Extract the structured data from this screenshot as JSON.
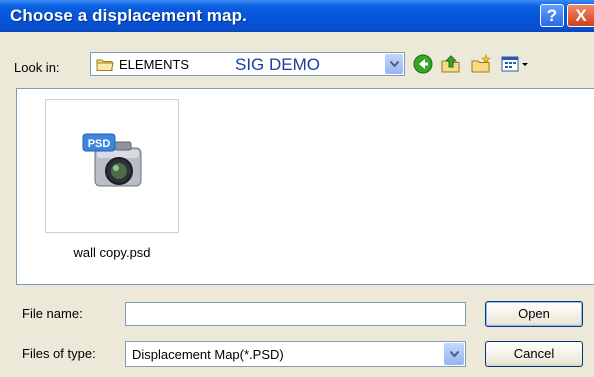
{
  "window": {
    "title": "Choose a displacement map.",
    "help_label": "?",
    "close_label": "X"
  },
  "lookin": {
    "label": "Look in:",
    "value": "ELEMENTS",
    "overlay": "SIG DEMO"
  },
  "toolbar": {
    "icons": [
      "back-icon",
      "up-folder-icon",
      "new-folder-icon",
      "view-menu-icon"
    ]
  },
  "files": [
    {
      "name": "wall copy.psd",
      "badge": "PSD",
      "icon": "psd-camera-icon"
    }
  ],
  "filename": {
    "label": "File name:",
    "value": ""
  },
  "filetype": {
    "label": "Files of type:",
    "value": "Displacement Map(*.PSD)"
  },
  "buttons": {
    "open": "Open",
    "cancel": "Cancel"
  },
  "colors": {
    "titlebar": "#0553d6",
    "face": "#ece9d8",
    "border": "#7f9db9",
    "button_border": "#003c74"
  }
}
